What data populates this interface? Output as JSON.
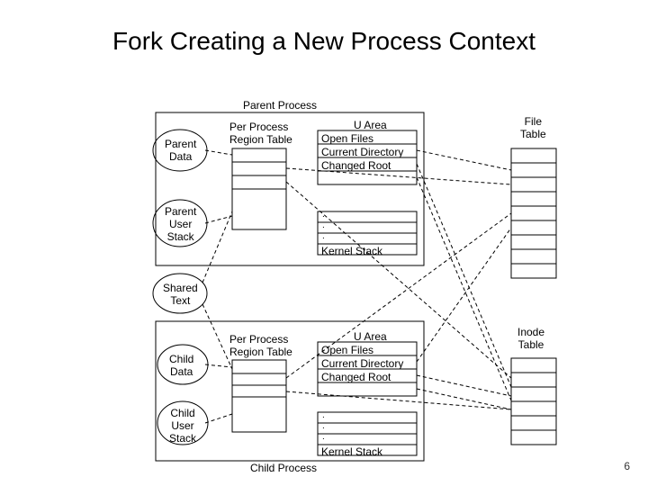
{
  "title": "Fork Creating a New Process Context",
  "labels": {
    "parent_process": "Parent Process",
    "child_process": "Child Process",
    "parent_data": "Parent\nData",
    "parent_user_stack": "Parent\nUser\nStack",
    "shared_text": "Shared\nText",
    "child_data": "Child\nData",
    "child_user_stack": "Child\nUser\nStack",
    "per_process_region_table": "Per Process\nRegion Table",
    "u_area": "U Area",
    "open_files": "Open Files",
    "current_directory": "Current Directory",
    "changed_root": "Changed Root",
    "kernel_stack": "Kernel Stack",
    "file_table": "File\nTable",
    "inode_table": "Inode\nTable",
    "dot": "."
  },
  "page_number": "6",
  "chart_data": {
    "type": "diagram",
    "description": "Process context diagram showing fork() duplicating parent process into child process",
    "parent_process_box": {
      "ovals": [
        "Parent Data",
        "Parent User Stack"
      ],
      "per_process_region_table_rows": 4,
      "u_area": [
        "Open Files",
        "Current Directory",
        "Changed Root"
      ],
      "kernel_stack_rows": 4
    },
    "child_process_box": {
      "ovals": [
        "Child Data",
        "Child User Stack"
      ],
      "per_process_region_table_rows": 4,
      "u_area": [
        "Open Files",
        "Current Directory",
        "Changed Root"
      ],
      "kernel_stack_rows": 4
    },
    "shared": [
      "Shared Text"
    ],
    "global_tables": {
      "file_table_rows": 9,
      "inode_table_rows": 6
    },
    "dashed_lines": [
      "Parent Data oval -> region table",
      "Parent User Stack oval -> region table",
      "Parent region table -> File Table",
      "Parent region table -> Inode Table",
      "Parent Open Files -> File Table",
      "Parent Current Directory -> Inode Table",
      "Parent Changed Root -> Inode Table",
      "Shared Text oval -> parent region table",
      "Shared Text oval -> child region table",
      "Child Data oval -> region table",
      "Child User Stack oval -> region table",
      "Child region table -> File Table",
      "Child region table -> Inode Table",
      "Child Open Files -> File Table",
      "Child Current Directory -> Inode Table",
      "Child Changed Root -> Inode Table"
    ]
  }
}
